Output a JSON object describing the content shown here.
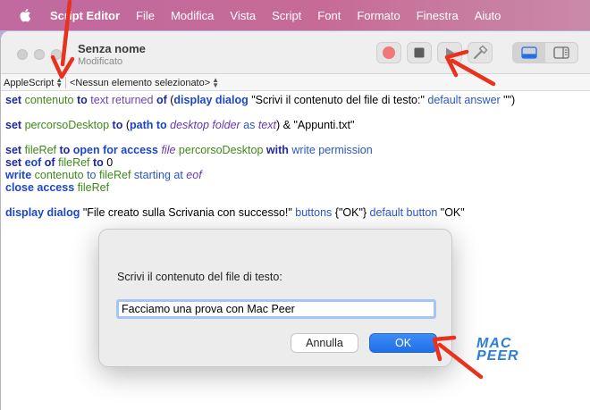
{
  "menubar": {
    "app_name": "Script Editor",
    "items": [
      "File",
      "Modifica",
      "Vista",
      "Script",
      "Font",
      "Formato",
      "Finestra",
      "Aiuto"
    ]
  },
  "window": {
    "title": "Senza nome",
    "subtitle": "Modificato"
  },
  "navbar": {
    "language": "AppleScript",
    "element": "<Nessun elemento selezionato>"
  },
  "editor": {
    "lines": [
      [
        [
          "kw",
          "set"
        ],
        [
          "txt",
          " "
        ],
        [
          "var",
          "contenuto"
        ],
        [
          "txt",
          " "
        ],
        [
          "kw",
          "to"
        ],
        [
          "txt",
          " "
        ],
        [
          "prop",
          "text returned"
        ],
        [
          "txt",
          " "
        ],
        [
          "kw",
          "of"
        ],
        [
          "txt",
          " ("
        ],
        [
          "cmd",
          "display dialog"
        ],
        [
          "txt",
          " \"Scrivi il contenuto del file di testo:\" "
        ],
        [
          "param",
          "default answer"
        ],
        [
          "txt",
          " \"\")"
        ]
      ],
      [],
      [
        [
          "kw",
          "set"
        ],
        [
          "txt",
          " "
        ],
        [
          "var",
          "percorsoDesktop"
        ],
        [
          "txt",
          " "
        ],
        [
          "kw",
          "to"
        ],
        [
          "txt",
          " ("
        ],
        [
          "cmd",
          "path to"
        ],
        [
          "txt",
          " "
        ],
        [
          "cls",
          "desktop folder"
        ],
        [
          "txt",
          " "
        ],
        [
          "param",
          "as"
        ],
        [
          "txt",
          " "
        ],
        [
          "cls",
          "text"
        ],
        [
          "txt",
          ") & \"Appunti.txt\""
        ]
      ],
      [],
      [
        [
          "kw",
          "set"
        ],
        [
          "txt",
          " "
        ],
        [
          "var",
          "fileRef"
        ],
        [
          "txt",
          " "
        ],
        [
          "kw",
          "to"
        ],
        [
          "txt",
          " "
        ],
        [
          "cmd",
          "open for access"
        ],
        [
          "txt",
          " "
        ],
        [
          "cls",
          "file"
        ],
        [
          "txt",
          " "
        ],
        [
          "var",
          "percorsoDesktop"
        ],
        [
          "txt",
          " "
        ],
        [
          "kw",
          "with"
        ],
        [
          "txt",
          " "
        ],
        [
          "param",
          "write permission"
        ]
      ],
      [
        [
          "kw",
          "set"
        ],
        [
          "txt",
          " "
        ],
        [
          "cmd",
          "eof"
        ],
        [
          "txt",
          " "
        ],
        [
          "kw",
          "of"
        ],
        [
          "txt",
          " "
        ],
        [
          "var",
          "fileRef"
        ],
        [
          "txt",
          " "
        ],
        [
          "kw",
          "to"
        ],
        [
          "txt",
          " 0"
        ]
      ],
      [
        [
          "cmd",
          "write"
        ],
        [
          "txt",
          " "
        ],
        [
          "var",
          "contenuto"
        ],
        [
          "txt",
          " "
        ],
        [
          "param",
          "to"
        ],
        [
          "txt",
          " "
        ],
        [
          "var",
          "fileRef"
        ],
        [
          "txt",
          " "
        ],
        [
          "param",
          "starting at"
        ],
        [
          "txt",
          " "
        ],
        [
          "cls",
          "eof"
        ]
      ],
      [
        [
          "cmd",
          "close access"
        ],
        [
          "txt",
          " "
        ],
        [
          "var",
          "fileRef"
        ]
      ],
      [],
      [
        [
          "cmd",
          "display dialog"
        ],
        [
          "txt",
          " \"File creato sulla Scrivania con successo!\" "
        ],
        [
          "param",
          "buttons"
        ],
        [
          "txt",
          " {\"OK\"} "
        ],
        [
          "param",
          "default button"
        ],
        [
          "txt",
          " \"OK\""
        ]
      ]
    ]
  },
  "dialog": {
    "prompt": "Scrivi il contenuto del file di testo:",
    "input_value": "Facciamo una prova con Mac Peer",
    "cancel_label": "Annulla",
    "ok_label": "OK"
  },
  "logo": {
    "line1": "MAC",
    "line2": "PEER"
  },
  "colors": {
    "menubar": "#c76b96",
    "accent": "#1f6fe8",
    "arrow": "#e8321e",
    "record": "#f0787a"
  },
  "icons": {
    "apple": "apple-logo-icon",
    "record": "record-icon",
    "stop": "stop-icon",
    "run": "play-icon",
    "compile": "hammer-icon",
    "view_bottom": "bottom-pane-icon",
    "view_side": "side-pane-icon"
  }
}
